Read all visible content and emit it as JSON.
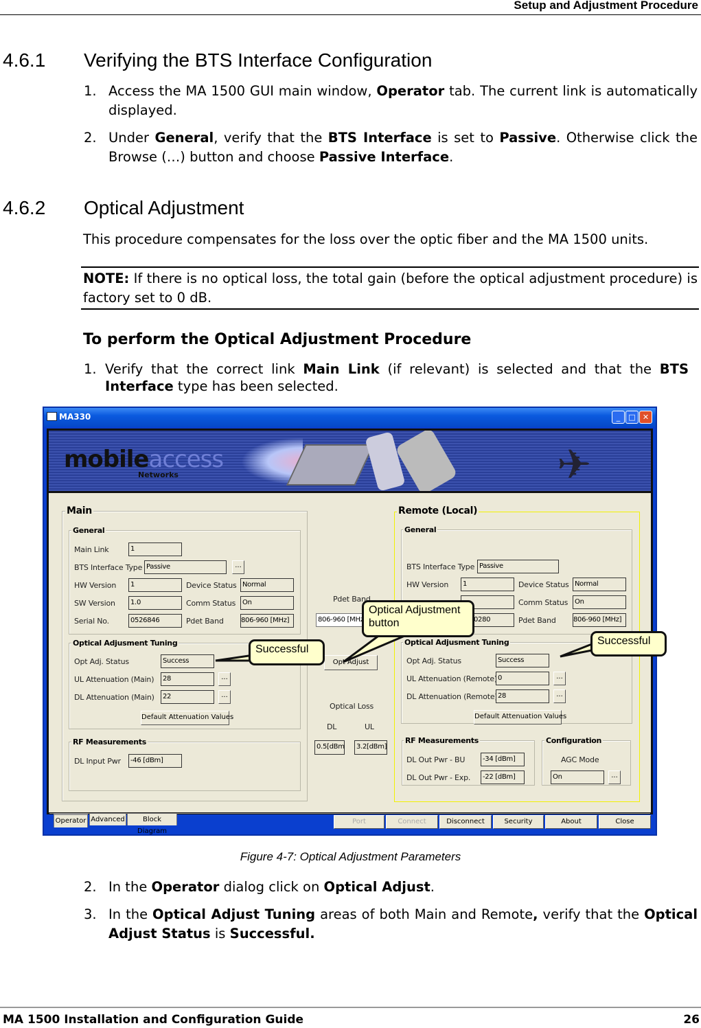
{
  "header": {
    "title": "Setup and Adjustment Procedure"
  },
  "section1": {
    "number": "4.6.1",
    "title": "Verifying the BTS Interface Configuration",
    "steps": [
      {
        "num": "1.",
        "parts": [
          "Access the MA 1500 GUI main window, ",
          "Operator",
          " tab. The current link is automatically displayed."
        ]
      },
      {
        "num": "2.",
        "parts": [
          "Under ",
          "General",
          ", verify that the ",
          "BTS Interface",
          " is set to ",
          "Passive",
          ". Otherwise click the Browse (…) button and choose ",
          "Passive Interface",
          "."
        ]
      }
    ]
  },
  "section2": {
    "number": "4.6.2",
    "title": "Optical Adjustment",
    "intro": "This procedure compensates for the loss over the optic fiber and the MA 1500 units.",
    "note": {
      "label": "NOTE:",
      "text": " If there is no optical loss, the total gain (before the optical adjustment procedure) is factory set to 0 dB."
    },
    "procedure_title": "To perform the Optical Adjustment Procedure",
    "step1": {
      "num": "1.",
      "parts": [
        "Verify that the correct link ",
        "Main Link",
        " (if relevant) is selected and that the ",
        "BTS Interface",
        " type has been selected."
      ]
    },
    "step2": {
      "num": "2.",
      "parts": [
        "In the ",
        "Operator",
        " dialog click on ",
        "Optical Adjust",
        "."
      ]
    },
    "step3": {
      "num": "3.",
      "parts": [
        "In the ",
        "Optical Adjust Tuning",
        " areas of both Main and Remote",
        ",",
        " verify that the ",
        "Optical Adjust Status",
        " is ",
        "Successful."
      ]
    }
  },
  "figure": {
    "caption": "Figure 4-7:  Optical Adjustment Parameters",
    "window": {
      "title": "MA330",
      "logo_main": "mobile",
      "logo_accent": "access",
      "logo_sub": "Networks"
    },
    "main": {
      "title": "Main",
      "general": {
        "title": "General",
        "main_link_label": "Main Link",
        "main_link": "1",
        "bts_label": "BTS Interface Type",
        "bts": "Passive",
        "browse": "...",
        "hw_label": "HW Version",
        "hw": "1",
        "sw_label": "SW Version",
        "sw": "1.0",
        "serial_label": "Serial No.",
        "serial": "0526846",
        "device_status_label": "Device Status",
        "device_status": "Normal",
        "comm_status_label": "Comm Status",
        "comm_status": "On",
        "pdet_label": "Pdet Band",
        "pdet": "806-960 [MHz]"
      },
      "tuning": {
        "title": "Optical Adjusment Tuning",
        "status_label": "Opt Adj. Status",
        "status": "Success",
        "ul_label": "UL Attenuation (Main)",
        "ul": "28",
        "dl_label": "DL Attenuation (Main)",
        "dl": "22",
        "browse": "...",
        "default_btn": "Default Attenuation Values"
      },
      "rf": {
        "title": "RF Measurements",
        "dl_in_label": "DL Input Pwr",
        "dl_in": "-46 [dBm]"
      }
    },
    "middle": {
      "pdet_label": "Pdet Band",
      "pdet": "806-960 [MHz]",
      "opt_adjust": "Opt Adjust",
      "loss_label": "Optical Loss",
      "dl_label": "DL",
      "ul_label": "UL",
      "dl": "0.5[dBm]",
      "ul": "3.2[dBm]"
    },
    "remote": {
      "title": "Remote (Local)",
      "general": {
        "title": "General",
        "bts_label": "BTS Interface Type",
        "bts": "Passive",
        "hw_label": "HW Version",
        "hw": "1",
        "serial": "0280",
        "device_status_label": "Device Status",
        "device_status": "Normal",
        "comm_status_label": "Comm Status",
        "comm_status": "On",
        "pdet_label": "Pdet Band",
        "pdet": "806-960 [MHz]"
      },
      "tuning": {
        "title": "Optical Adjusment Tuning",
        "status_label": "Opt Adj. Status",
        "status": "Success",
        "ul_label": "UL Attenuation (Remote)",
        "ul": "0",
        "dl_label": "DL Attenuation (Remote)",
        "dl": "28",
        "browse": "...",
        "default_btn": "Default Attenuation Values"
      },
      "rf": {
        "title": "RF Measurements",
        "bu_label": "DL Out Pwr - BU",
        "bu": "-34 [dBm]",
        "exp_label": "DL Out Pwr - Exp.",
        "exp": "-22 [dBm]"
      },
      "config": {
        "title": "Configuration",
        "agc_label": "AGC Mode",
        "agc": "On",
        "browse": "..."
      }
    },
    "tabs": [
      "Operator",
      "Advanced",
      "Block Diagram"
    ],
    "buttons": [
      "Port",
      "Connect",
      "Disconnect",
      "Security",
      "About",
      "Close"
    ],
    "callouts": {
      "left": "Successful",
      "center": "Optical Adjustment button",
      "right": "Successful"
    }
  },
  "footer": {
    "title": "MA 1500 Installation and Configuration Guide",
    "page": "26"
  }
}
